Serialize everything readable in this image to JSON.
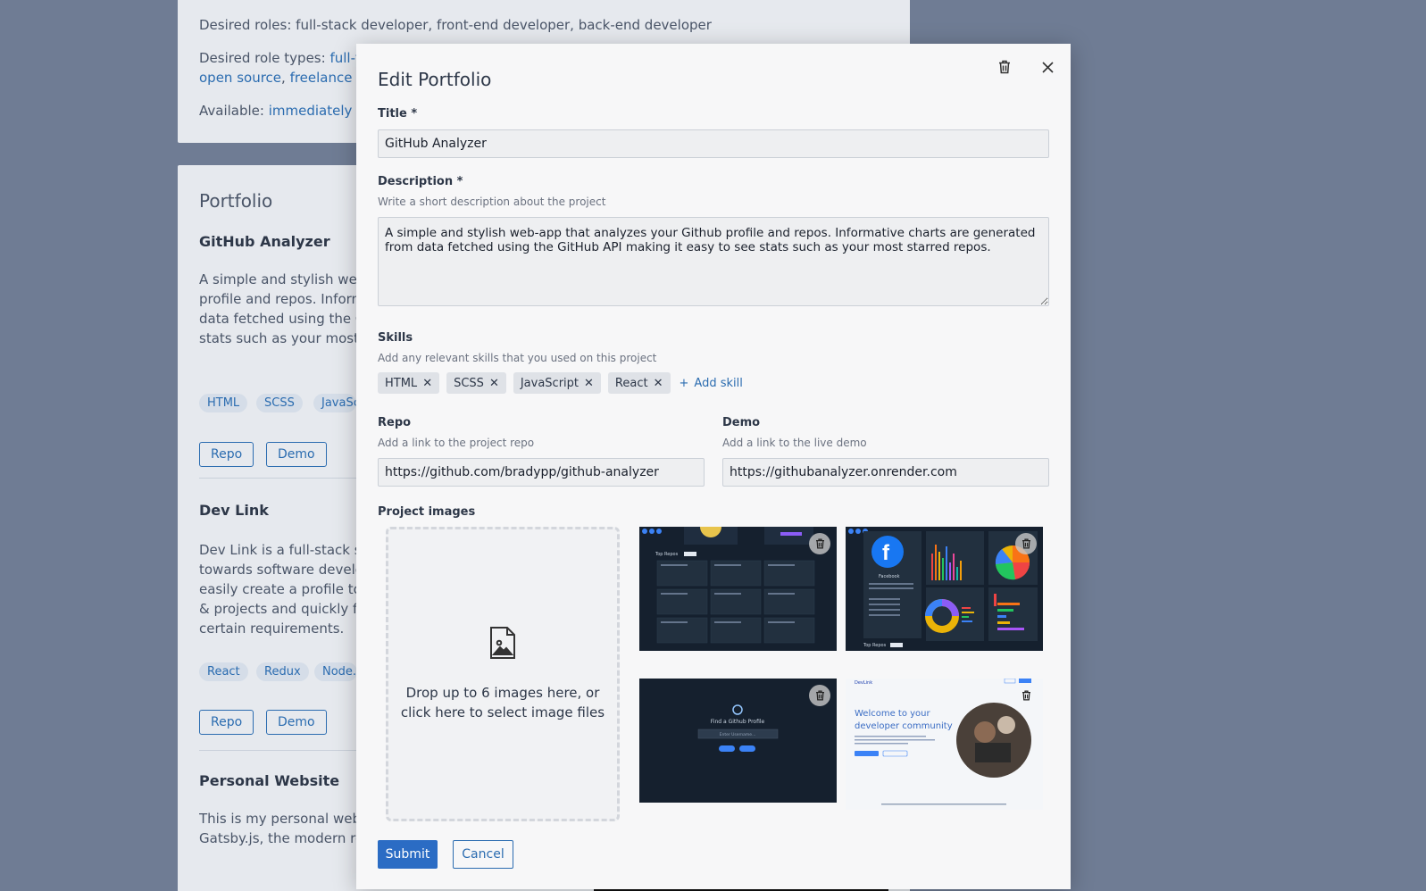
{
  "background": {
    "desired_roles": "Desired roles: full-stack developer, front-end developer, back-end developer",
    "desired_role_types_label": "Desired role types:",
    "desired_role_types_link": "full-ti",
    "role_link_open_source": "open source",
    "role_link_freelance": "freelance",
    "available_label": "Available:",
    "available_value": "immediately",
    "portfolio_heading": "Portfolio",
    "projects": [
      {
        "title": "GitHub Analyzer",
        "desc_lines": [
          "A simple and stylish web",
          "profile and repos. Informa",
          "data fetched using the G",
          "stats such as your most s"
        ],
        "tags": [
          "HTML",
          "SCSS",
          "JavaSc"
        ],
        "repo": "Repo",
        "demo": "Demo"
      },
      {
        "title": "Dev Link",
        "desc_lines": [
          "Dev Link is a full-stack so",
          "towards software develo",
          "easily create a profile to s",
          "& projects and quickly fin",
          "certain requirements."
        ],
        "tags": [
          "React",
          "Redux",
          "Node."
        ],
        "repo": "Repo",
        "demo": "Demo"
      },
      {
        "title": "Personal Website",
        "desc_lines": [
          "This is my personal webs",
          "Gatsby.js, the modern re"
        ]
      }
    ]
  },
  "modal": {
    "title": "Edit Portfolio",
    "delete_icon": "trash-icon",
    "close_icon": "close-icon",
    "title_label": "Title *",
    "title_value": "GitHub Analyzer",
    "description_label": "Description *",
    "description_help": "Write a short description about the project",
    "description_value": "A simple and stylish web-app that analyzes your Github profile and repos. Informative charts are generated from data fetched using the GitHub API making it easy to see stats such as your most starred repos.",
    "skills_label": "Skills",
    "skills_help": "Add any relevant skills that you used on this project",
    "skills": [
      "HTML",
      "SCSS",
      "JavaScript",
      "React"
    ],
    "add_skill": "Add skill",
    "repo_label": "Repo",
    "repo_help": "Add a link to the project repo",
    "repo_value": "https://github.com/bradypp/github-analyzer",
    "demo_label": "Demo",
    "demo_help": "Add a link to the live demo",
    "demo_value": "https://githubanalyzer.onrender.com",
    "images_label": "Project images",
    "dropzone_text": "Drop up to 6 images here, or click here to select image files",
    "image_thumbs": [
      {
        "content": "dashboard-repos-screenshot",
        "lines": [
          "Top Repos"
        ]
      },
      {
        "content": "dashboard-charts-screenshot",
        "lines": [
          "Facebook",
          "Top Repos"
        ]
      },
      {
        "content": "find-github-profile-screenshot",
        "lines": [
          "Find a Github Profile",
          "Enter Username..."
        ]
      },
      {
        "content": "devlink-landing-screenshot",
        "lines": [
          "DevLink",
          "Welcome to your",
          "developer community"
        ]
      }
    ],
    "submit": "Submit",
    "cancel": "Cancel"
  },
  "colors": {
    "overlay": "#6f7c94",
    "primary": "#2b6cc4",
    "link": "#2b6cb0",
    "dark_thumb": "#15202e"
  }
}
